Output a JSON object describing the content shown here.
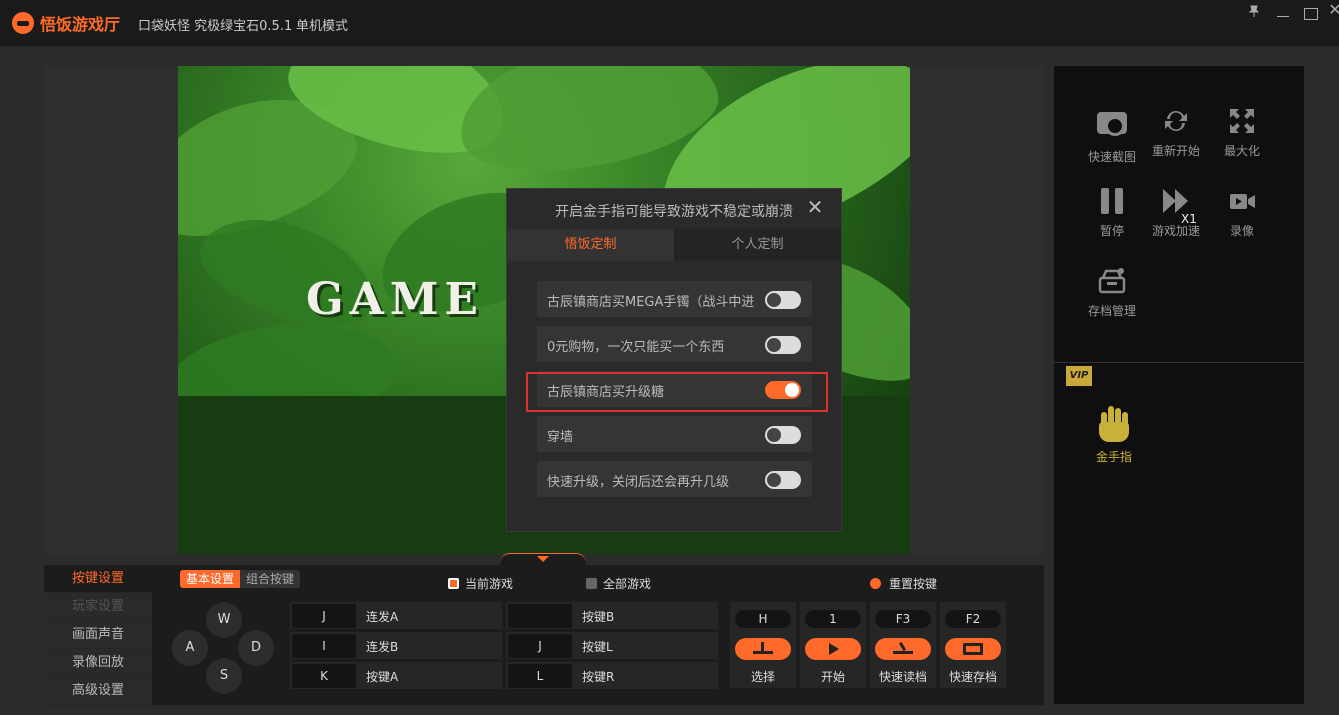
{
  "titlebar": {
    "app_name": "悟饭游戏厅",
    "game_title": "口袋妖怪 究极绿宝石0.5.1",
    "mode": "单机模式",
    "pin_icon": "pin-icon",
    "minimize_icon": "minimize-icon",
    "maximize_icon": "maximize-icon",
    "close_label": "✕"
  },
  "game": {
    "screen_text": "GAME"
  },
  "cheat_dialog": {
    "title": "开启金手指可能导致游戏不稳定或崩溃",
    "close_label": "✕",
    "tabs": [
      {
        "label": "悟饭定制",
        "active": true
      },
      {
        "label": "个人定制",
        "active": false
      }
    ],
    "cheats": [
      {
        "label": "古辰镇商店买MEGA手镯（战斗中进",
        "on": false
      },
      {
        "label": "0元购物，一次只能买一个东西",
        "on": false
      },
      {
        "label": "古辰镇商店买升级糖",
        "on": true,
        "highlighted": true
      },
      {
        "label": "穿墙",
        "on": false
      },
      {
        "label": "快速升级，关闭后还会再升几级",
        "on": false
      }
    ],
    "accent_color": "#ff6a2b",
    "highlight_color": "#e03030"
  },
  "side_panel": {
    "tools": [
      {
        "label": "快速截图",
        "icon": "camera-icon"
      },
      {
        "label": "重新开始",
        "icon": "refresh-icon"
      },
      {
        "label": "最大化",
        "icon": "expand-icon"
      },
      {
        "label": "暂停",
        "icon": "pause-icon"
      },
      {
        "label": "游戏加速",
        "icon": "fast-forward-icon",
        "badge": "X1"
      },
      {
        "label": "录像",
        "icon": "video-icon"
      },
      {
        "label": "存档管理",
        "icon": "archive-icon"
      }
    ],
    "vip_badge": "VIP",
    "cheat_tool": {
      "label": "金手指",
      "icon": "hand-icon",
      "color": "#c9b03a"
    }
  },
  "bottom_panel": {
    "menu": [
      {
        "label": "按键设置",
        "active": true
      },
      {
        "label": "玩家设置",
        "dim": true
      },
      {
        "label": "画面声音"
      },
      {
        "label": "录像回放"
      },
      {
        "label": "高级设置"
      }
    ],
    "subtabs": [
      {
        "label": "基本设置",
        "active": true
      },
      {
        "label": "组合按键",
        "active": false
      }
    ],
    "scope": {
      "current_game": "当前游戏",
      "all_games": "全部游戏",
      "selected": "current_game"
    },
    "reset_keys": "重置按键",
    "dpad": {
      "up": "W",
      "left": "A",
      "right": "D",
      "down": "S"
    },
    "key_rows": [
      [
        {
          "key": "J",
          "name": "连发A"
        },
        {
          "key": "",
          "name": "按键B"
        }
      ],
      [
        {
          "key": "I",
          "name": "连发B"
        },
        {
          "key": "J",
          "name": "按键L"
        }
      ],
      [
        {
          "key": "K",
          "name": "按键A"
        },
        {
          "key": "L",
          "name": "按键R"
        }
      ]
    ],
    "function_keys": [
      {
        "key": "H",
        "label": "选择",
        "icon": "select-icon"
      },
      {
        "key": "1",
        "label": "开始",
        "icon": "play-icon"
      },
      {
        "key": "F3",
        "label": "快速读档",
        "icon": "load-icon"
      },
      {
        "key": "F2",
        "label": "快速存档",
        "icon": "save-icon"
      }
    ]
  }
}
